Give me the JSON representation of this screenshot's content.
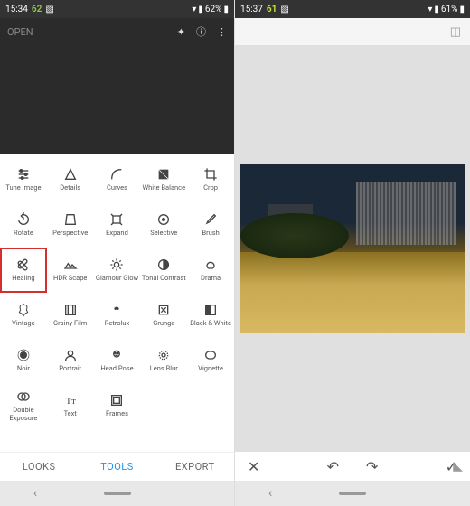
{
  "left": {
    "status": {
      "time": "15:34",
      "temp": "62",
      "battery": "62%"
    },
    "header": {
      "open": "OPEN"
    },
    "tools": [
      {
        "id": "tune-image",
        "label": "Tune Image",
        "icon": "sliders"
      },
      {
        "id": "details",
        "label": "Details",
        "icon": "triangle"
      },
      {
        "id": "curves",
        "label": "Curves",
        "icon": "curve"
      },
      {
        "id": "white-balance",
        "label": "White Balance",
        "icon": "wb"
      },
      {
        "id": "crop",
        "label": "Crop",
        "icon": "crop"
      },
      {
        "id": "rotate",
        "label": "Rotate",
        "icon": "rotate"
      },
      {
        "id": "perspective",
        "label": "Perspective",
        "icon": "perspective"
      },
      {
        "id": "expand",
        "label": "Expand",
        "icon": "expand"
      },
      {
        "id": "selective",
        "label": "Selective",
        "icon": "selective"
      },
      {
        "id": "brush",
        "label": "Brush",
        "icon": "brush"
      },
      {
        "id": "healing",
        "label": "Healing",
        "icon": "healing",
        "highlighted": true
      },
      {
        "id": "hdr-scape",
        "label": "HDR Scape",
        "icon": "hdr"
      },
      {
        "id": "glamour-glow",
        "label": "Glamour Glow",
        "icon": "glow"
      },
      {
        "id": "tonal-contrast",
        "label": "Tonal Contrast",
        "icon": "tonal"
      },
      {
        "id": "drama",
        "label": "Drama",
        "icon": "drama"
      },
      {
        "id": "vintage",
        "label": "Vintage",
        "icon": "vintage"
      },
      {
        "id": "grainy-film",
        "label": "Grainy Film",
        "icon": "film"
      },
      {
        "id": "retrolux",
        "label": "Retrolux",
        "icon": "retrolux"
      },
      {
        "id": "grunge",
        "label": "Grunge",
        "icon": "grunge"
      },
      {
        "id": "black-white",
        "label": "Black & White",
        "icon": "bw"
      },
      {
        "id": "noir",
        "label": "Noir",
        "icon": "noir"
      },
      {
        "id": "portrait",
        "label": "Portrait",
        "icon": "portrait"
      },
      {
        "id": "head-pose",
        "label": "Head Pose",
        "icon": "headpose"
      },
      {
        "id": "lens-blur",
        "label": "Lens Blur",
        "icon": "lensblur"
      },
      {
        "id": "vignette",
        "label": "Vignette",
        "icon": "vignette"
      },
      {
        "id": "double-exposure",
        "label": "Double Exposure",
        "icon": "double"
      },
      {
        "id": "text",
        "label": "Text",
        "icon": "text"
      },
      {
        "id": "frames",
        "label": "Frames",
        "icon": "frames"
      }
    ],
    "tabs": {
      "looks": "LOOKS",
      "tools": "TOOLS",
      "export": "EXPORT"
    }
  },
  "right": {
    "status": {
      "time": "15:37",
      "temp": "61",
      "battery": "61%"
    }
  }
}
